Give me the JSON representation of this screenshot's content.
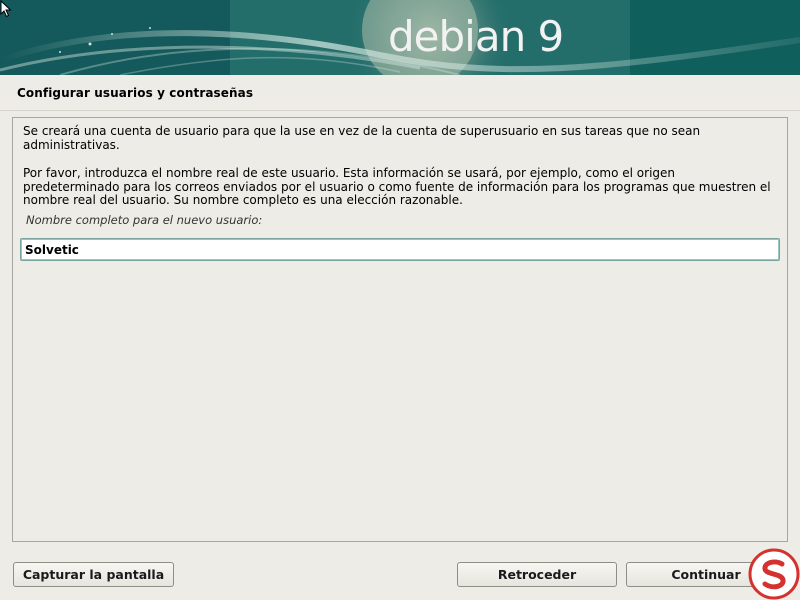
{
  "banner": {
    "title": "debian 9"
  },
  "section": {
    "title": "Configurar usuarios y contraseñas"
  },
  "panel": {
    "paragraph_1": "Se creará una cuenta de usuario para que la use en vez de la cuenta de superusuario en sus tareas que no sean administrativas.",
    "paragraph_2": "Por favor, introduzca el nombre real de este usuario. Esta información se usará, por ejemplo, como el origen predeterminado para los correos enviados por el usuario o como fuente de información para los programas que muestren el nombre real del usuario. Su nombre completo es una elección razonable.",
    "field_label": "Nombre completo para el nuevo usuario:",
    "field_value": "Solvetic"
  },
  "buttons": {
    "screenshot": "Capturar la pantalla",
    "back": "Retroceder",
    "continue": "Continuar"
  },
  "colors": {
    "banner_teal": "#1c6a6a",
    "background": "#edece6",
    "input_focus_border": "#7aa4a0",
    "watermark_red": "#d4322f"
  },
  "icons": {
    "cursor": "mouse-pointer-icon",
    "watermark": "solvetic-logo-icon"
  }
}
